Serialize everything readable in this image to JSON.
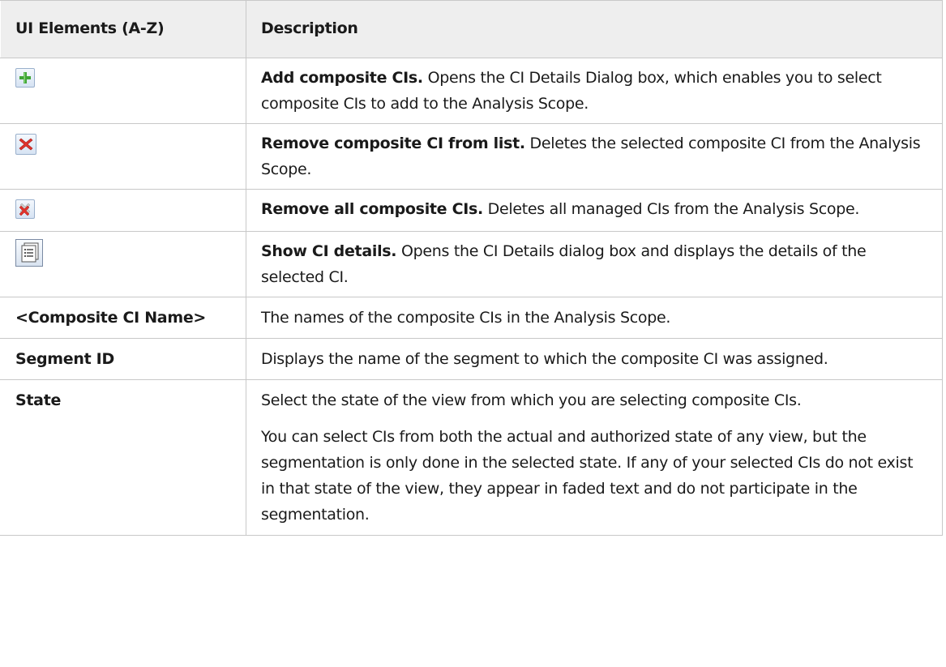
{
  "table": {
    "headers": {
      "col1": "UI Elements (A-Z)",
      "col2": "Description"
    },
    "rows": [
      {
        "icon": "add-icon",
        "bold": "Add composite CIs.",
        "text": " Opens the CI Details Dialog box, which enables you to select composite CIs to add to the Analysis Scope."
      },
      {
        "icon": "remove-icon",
        "bold": "Remove composite CI from list.",
        "text": " Deletes the selected composite CI from the Analysis Scope."
      },
      {
        "icon": "remove-all-icon",
        "bold": "Remove all composite CIs.",
        "text": " Deletes all managed CIs from the Analysis Scope."
      },
      {
        "icon": "details-icon",
        "bold": "Show CI details.",
        "text": " Opens the CI Details dialog box and displays the details of the selected CI."
      },
      {
        "name": "<Composite CI Name>",
        "text": "The names of the composite CIs in the Analysis Scope."
      },
      {
        "name": "Segment ID",
        "text": "Displays the name of the segment to which the composite CI was assigned."
      },
      {
        "name": "State",
        "text": "Select the state of the view from which you are selecting composite CIs.",
        "text2": "You can select CIs from both the actual and authorized state of any view, but the segmentation is only done in the selected state. If any of your selected CIs do not exist in that state of the view, they appear in faded text and do not participate in the segmentation."
      }
    ]
  },
  "colors": {
    "header_bg": "#eeeeee",
    "border": "#c8c8c8",
    "add_green": "#3fa535",
    "remove_red": "#e0322b"
  }
}
